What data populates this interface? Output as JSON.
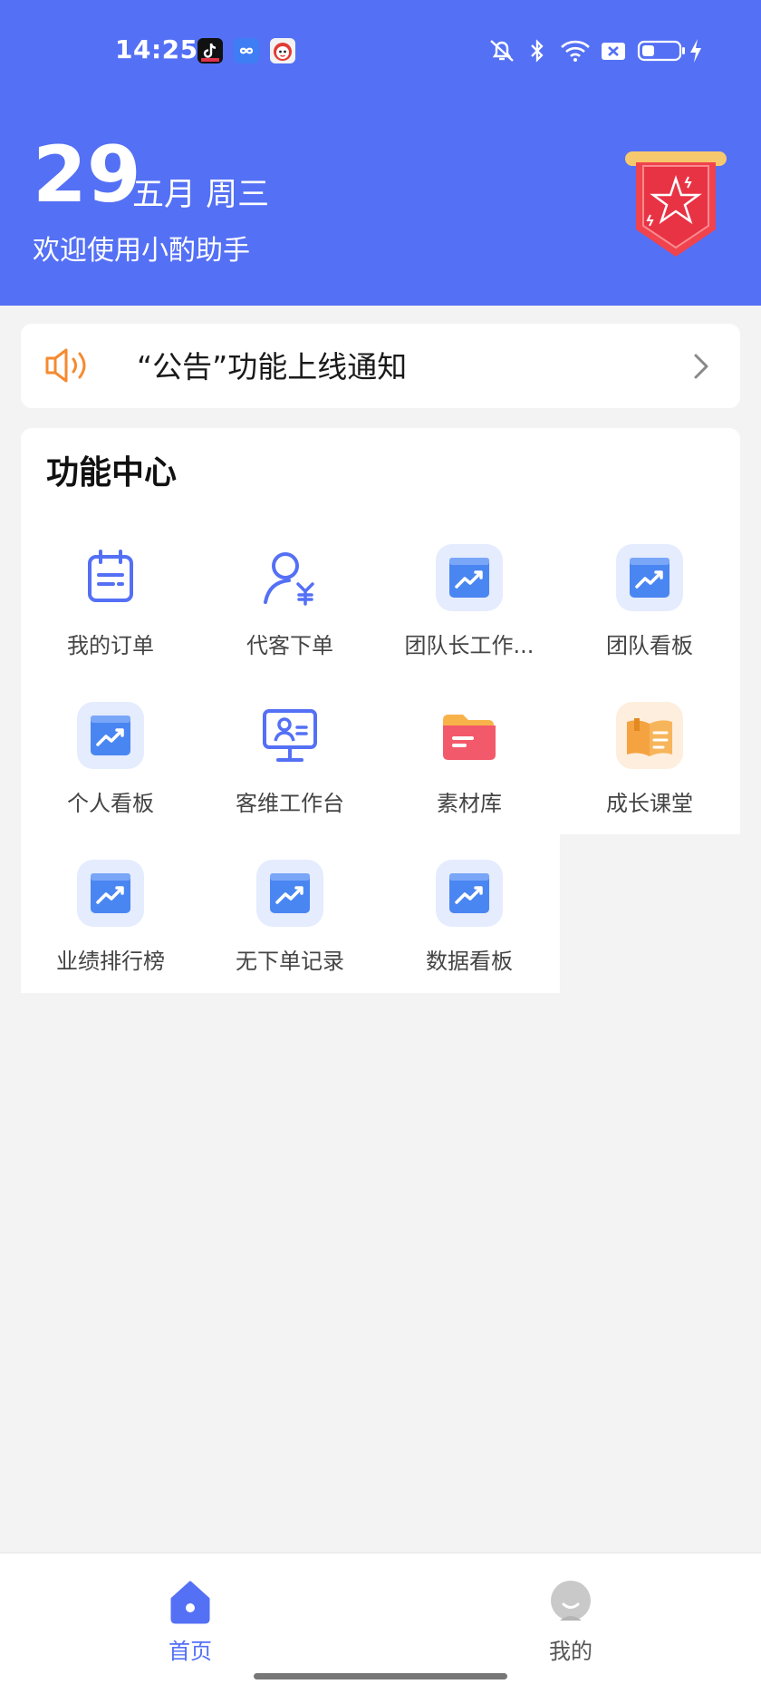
{
  "status_bar": {
    "time": "14:25",
    "app_icons": [
      "tiktok-icon",
      "infinity-icon",
      "mascot-icon"
    ],
    "system_icons": [
      "mute-icon",
      "bluetooth-icon",
      "wifi-icon",
      "sim-off-icon",
      "battery-icon",
      "charging-icon"
    ]
  },
  "header": {
    "day": "29",
    "date_text": "五月 周三",
    "welcome": "欢迎使用小酌助手",
    "background_color": "#5470f5"
  },
  "notice": {
    "text": "“公告”功能上线通知",
    "icon": "speaker-icon"
  },
  "feature_center": {
    "title": "功能中心",
    "items": [
      {
        "label": "我的订单",
        "icon": "calendar-order-icon"
      },
      {
        "label": "代客下单",
        "icon": "user-yuan-icon"
      },
      {
        "label": "团队长工作...",
        "icon": "chart-board-icon"
      },
      {
        "label": "团队看板",
        "icon": "chart-board-icon"
      },
      {
        "label": "个人看板",
        "icon": "chart-board-icon"
      },
      {
        "label": "客维工作台",
        "icon": "monitor-user-icon"
      },
      {
        "label": "素材库",
        "icon": "folder-icon"
      },
      {
        "label": "成长课堂",
        "icon": "book-icon"
      },
      {
        "label": "业绩排行榜",
        "icon": "chart-board-icon"
      },
      {
        "label": "无下单记录",
        "icon": "chart-board-icon"
      },
      {
        "label": "数据看板",
        "icon": "chart-board-icon"
      }
    ]
  },
  "tabbar": {
    "tabs": [
      {
        "label": "首页",
        "icon": "home-icon",
        "active": true
      },
      {
        "label": "我的",
        "icon": "profile-icon",
        "active": false
      }
    ],
    "active_color": "#5470f5",
    "inactive_color": "#555555"
  }
}
